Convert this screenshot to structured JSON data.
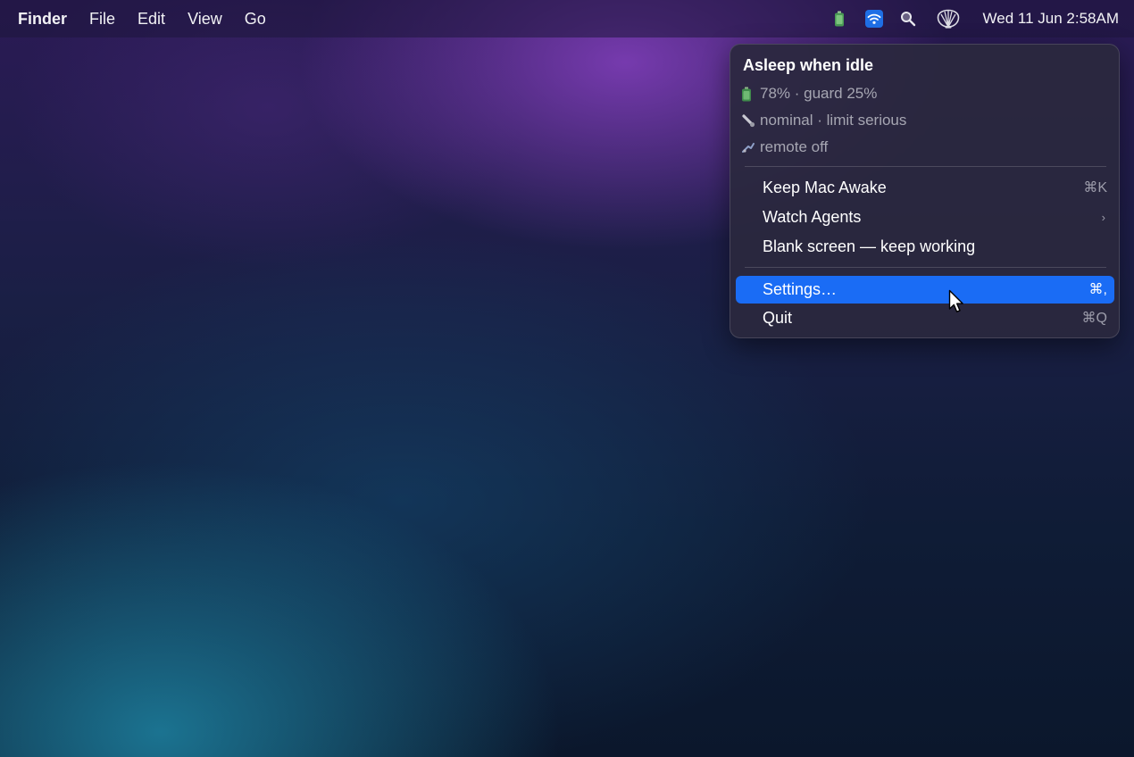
{
  "menubar": {
    "app_name": "Finder",
    "menus": [
      "File",
      "Edit",
      "View",
      "Go"
    ],
    "status_icons": [
      "battery-icon",
      "wifi-icon",
      "search-icon",
      "shell-icon"
    ],
    "clock": "Wed 11 Jun  2:58AM"
  },
  "dropdown": {
    "header": "Asleep when idle",
    "info": [
      {
        "icon": "battery-icon",
        "text": "78% · guard 25%"
      },
      {
        "icon": "thermometer-icon",
        "text": "nominal · limit serious"
      },
      {
        "icon": "remote-icon",
        "text": "remote off"
      }
    ],
    "items": {
      "keep_awake": {
        "label": "Keep Mac Awake",
        "shortcut": "⌘K"
      },
      "watch_agents": {
        "label": "Watch Agents",
        "submenu": "›"
      },
      "blank_screen": {
        "label": "Blank screen — keep working"
      },
      "settings": {
        "label": "Settings…",
        "shortcut": "⌘,"
      },
      "quit": {
        "label": "Quit",
        "shortcut": "⌘Q"
      }
    }
  },
  "colors": {
    "highlight": "#1a6cf5",
    "menu_background": "#2a283e",
    "secondary_text": "#a6a6b2"
  }
}
